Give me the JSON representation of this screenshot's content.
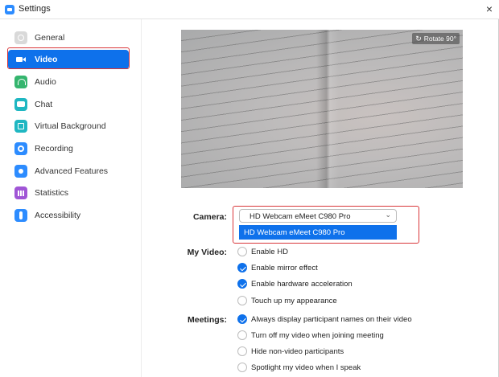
{
  "window": {
    "title": "Settings",
    "close_glyph": "×"
  },
  "sidebar": {
    "items": [
      {
        "label": "General",
        "icon": "gear-icon"
      },
      {
        "label": "Video",
        "icon": "video-camera-icon",
        "active": true
      },
      {
        "label": "Audio",
        "icon": "headphones-icon"
      },
      {
        "label": "Chat",
        "icon": "chat-bubble-icon"
      },
      {
        "label": "Virtual Background",
        "icon": "person-frame-icon"
      },
      {
        "label": "Recording",
        "icon": "record-icon"
      },
      {
        "label": "Advanced Features",
        "icon": "sparkle-icon"
      },
      {
        "label": "Statistics",
        "icon": "bar-chart-icon"
      },
      {
        "label": "Accessibility",
        "icon": "accessibility-icon"
      }
    ]
  },
  "preview": {
    "rotate_label": "Rotate 90°",
    "rotate_glyph": "↻"
  },
  "camera": {
    "label": "Camera:",
    "selected": "HD Webcam eMeet C980 Pro",
    "chevron": "⌄",
    "options": [
      "HD Webcam eMeet C980 Pro"
    ]
  },
  "my_video": {
    "label": "My Video:",
    "options": [
      {
        "label": "Enable HD",
        "checked": false
      },
      {
        "label": "Enable mirror effect",
        "checked": true
      },
      {
        "label": "Enable hardware acceleration",
        "checked": true
      },
      {
        "label": "Touch up my appearance",
        "checked": false
      }
    ]
  },
  "meetings": {
    "label": "Meetings:",
    "options": [
      {
        "label": "Always display participant names on their video",
        "checked": true
      },
      {
        "label": "Turn off my video when joining meeting",
        "checked": false
      },
      {
        "label": "Hide non-video participants",
        "checked": false
      },
      {
        "label": "Spotlight my video when I speak",
        "checked": false
      }
    ]
  },
  "colors": {
    "accent": "#0e71eb",
    "highlight_border": "#d9373a"
  }
}
